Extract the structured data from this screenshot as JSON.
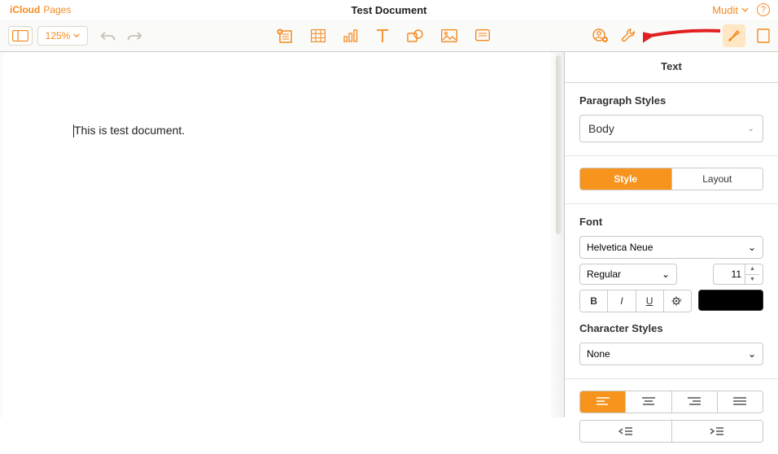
{
  "titlebar": {
    "brand": "iCloud",
    "app": "Pages",
    "document": "Test Document",
    "user": "Mudit",
    "help": "?"
  },
  "toolbar": {
    "zoom": "125%"
  },
  "document": {
    "text": "This is test document."
  },
  "inspector": {
    "tab": "Text",
    "paragraph_styles_label": "Paragraph Styles",
    "paragraph_style": "Body",
    "seg_style": "Style",
    "seg_layout": "Layout",
    "font_label": "Font",
    "font_family": "Helvetica Neue",
    "font_weight": "Regular",
    "font_size": "11",
    "bold": "B",
    "italic": "I",
    "underline": "U",
    "character_styles_label": "Character Styles",
    "character_style": "None"
  }
}
